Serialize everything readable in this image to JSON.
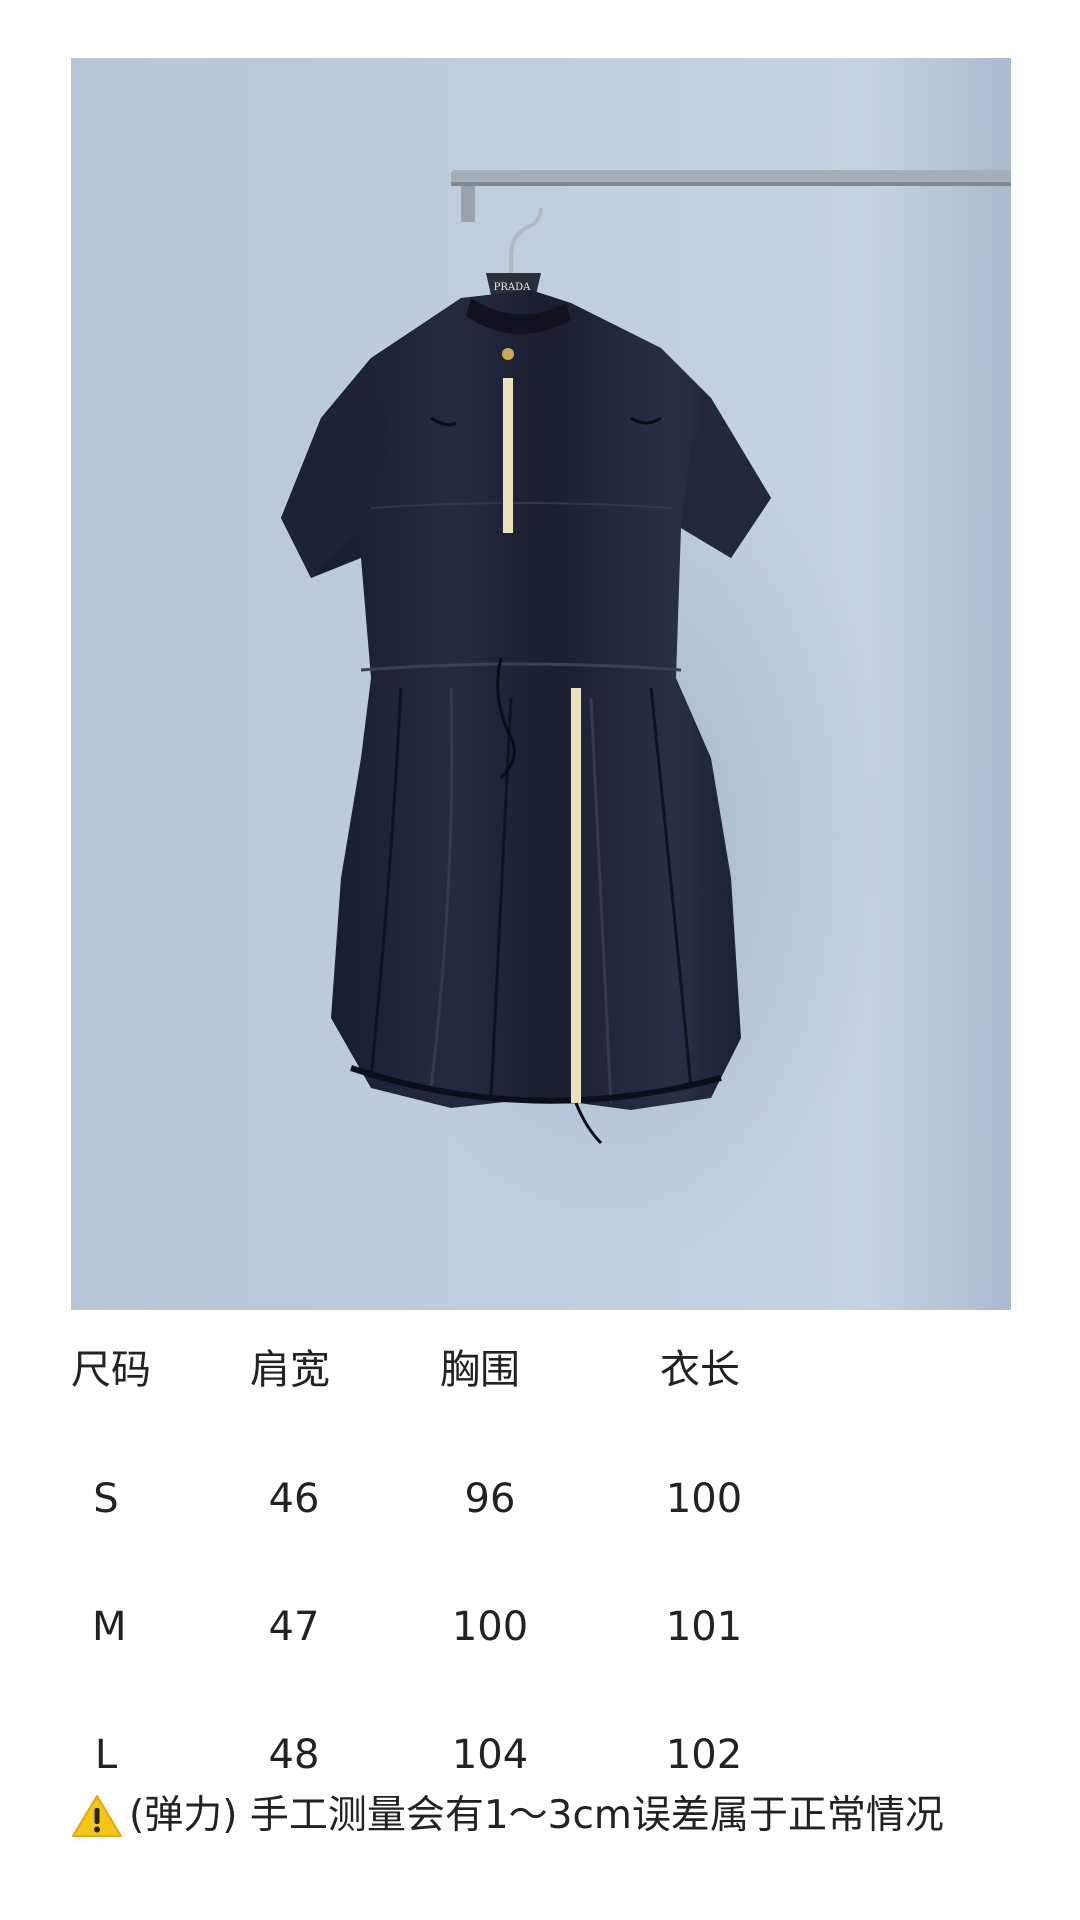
{
  "photo": {
    "hanger_brand": "PRADA"
  },
  "size_table": {
    "headers": [
      "尺码",
      "肩宽",
      "胸围",
      "衣长"
    ],
    "rows": [
      [
        "S",
        "46",
        "96",
        "100"
      ],
      [
        "M",
        "47",
        "100",
        "101"
      ],
      [
        "L",
        "48",
        "104",
        "102"
      ]
    ]
  },
  "note": {
    "icon": "warning-icon",
    "text": "(弹力) 手工测量会有1～3cm误差属于正常情况"
  },
  "colors": {
    "wall": "#bccbdc",
    "dress": "#1c2032",
    "zipper": "#e8dcb4",
    "warning": "#f5c518"
  }
}
